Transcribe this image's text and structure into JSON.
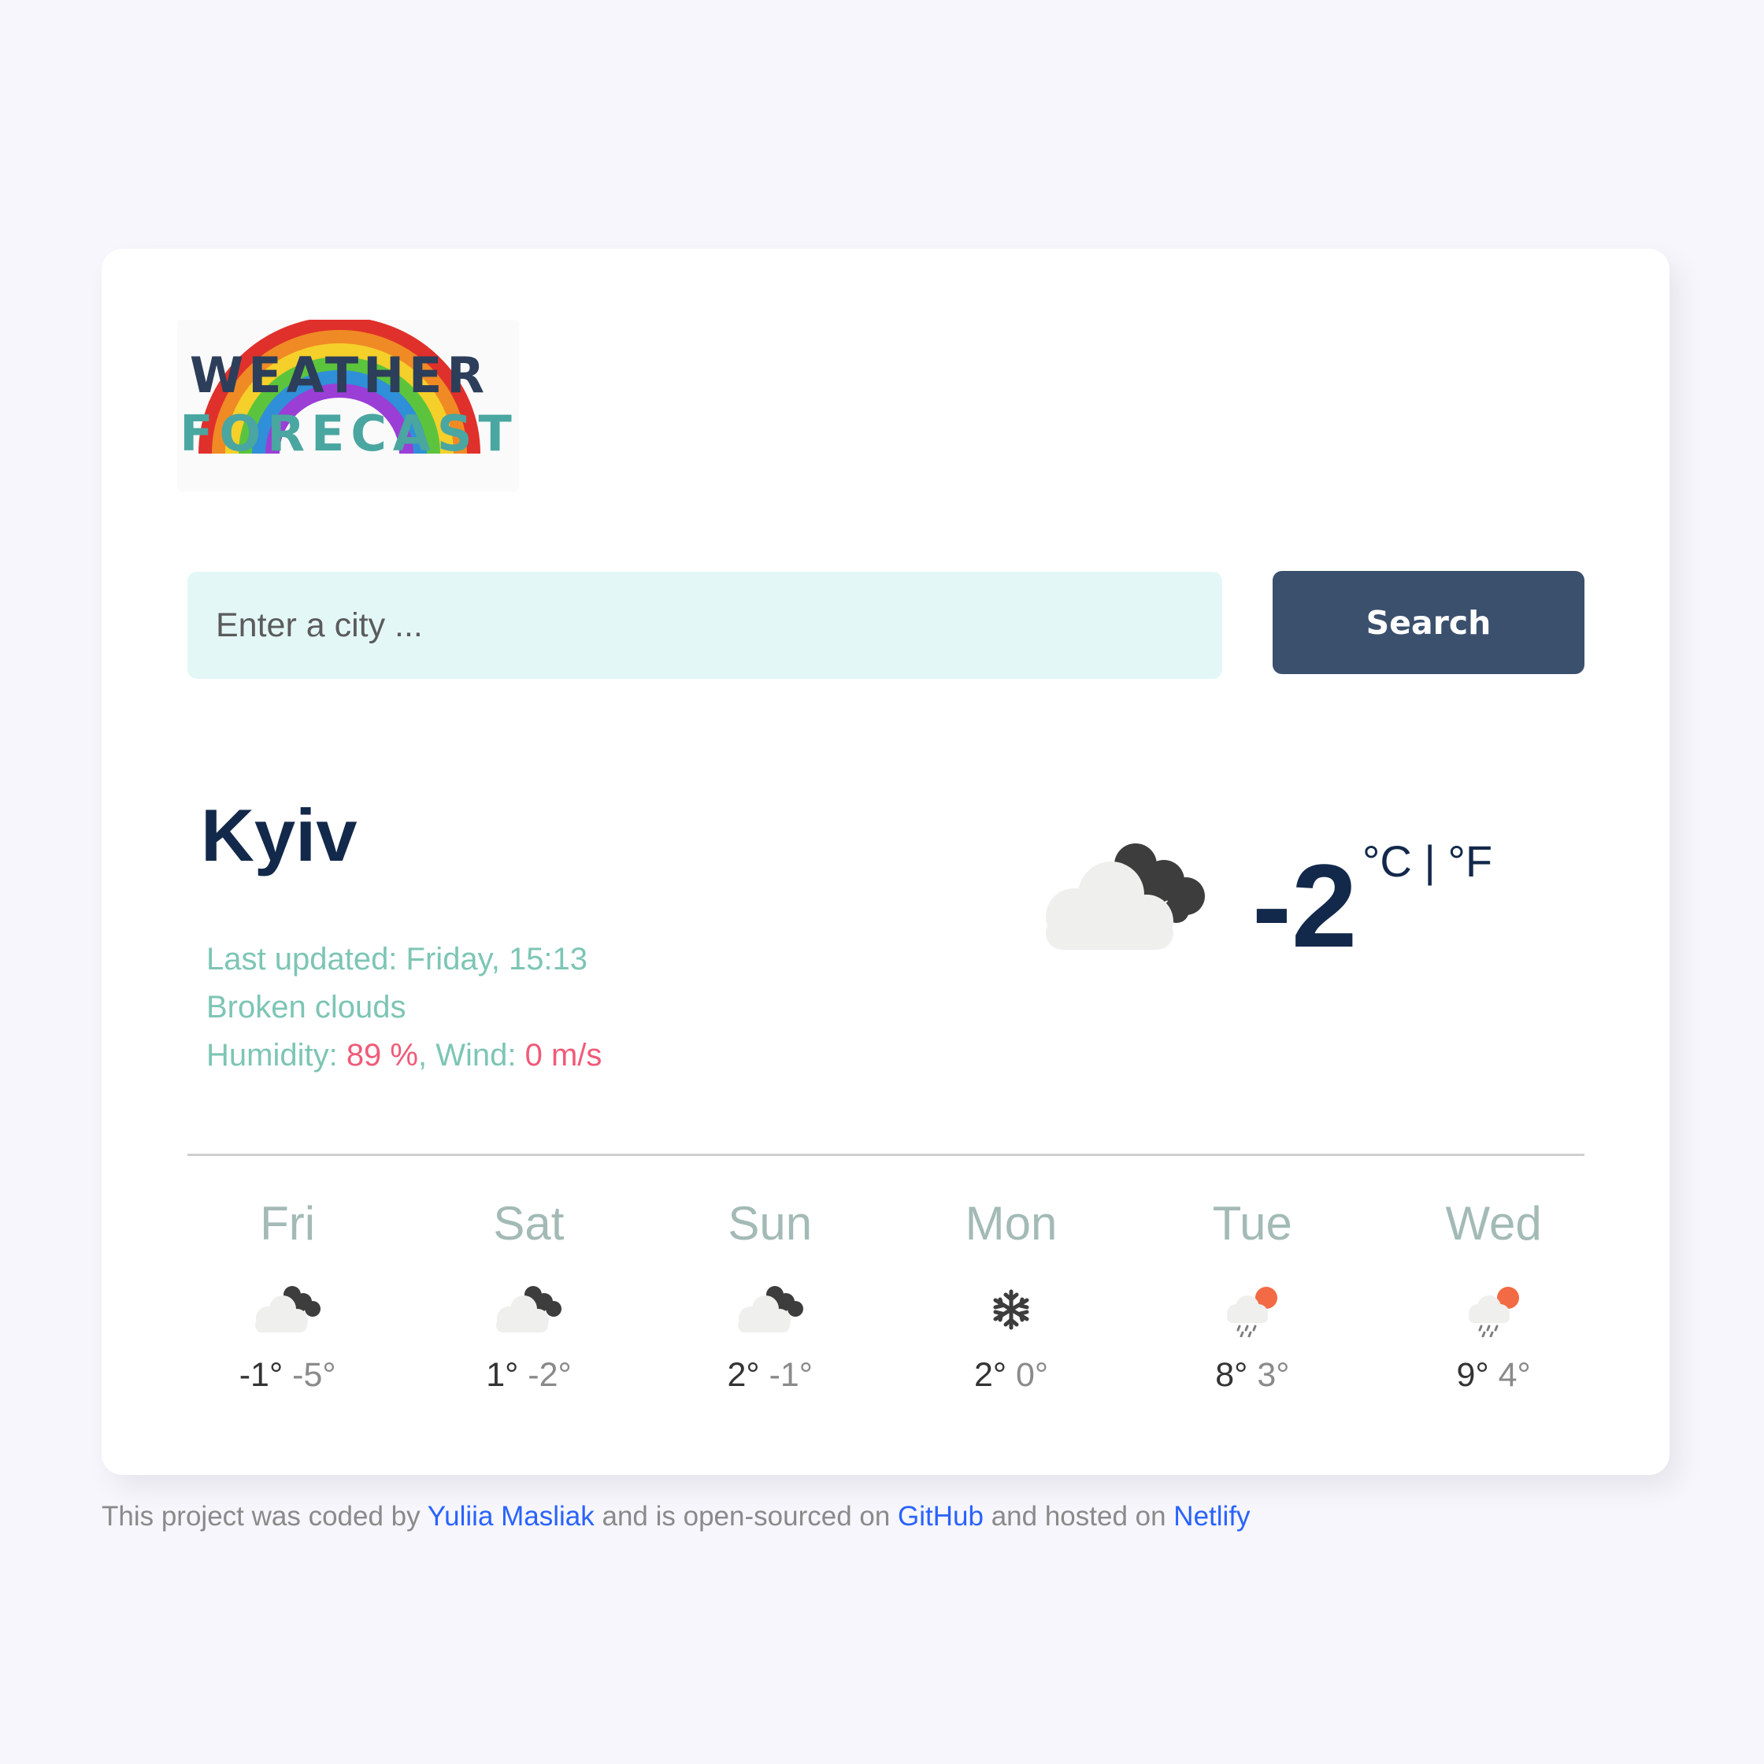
{
  "header": {
    "logo_text_line1": "WEATHER",
    "logo_text_line2": "FORECAST"
  },
  "search": {
    "placeholder": "Enter a city ...",
    "value": "",
    "button_label": "Search"
  },
  "current": {
    "city": "Kyiv",
    "last_updated_label": "Last updated: ",
    "last_updated_value": "Friday, 15:13",
    "description": "Broken clouds",
    "humidity_label": "Humidity: ",
    "humidity_value": "89 %",
    "wind_label": ", Wind: ",
    "wind_value": "0 m/s",
    "temperature": "-2",
    "unit_celsius": "°C",
    "unit_separator": " | ",
    "unit_fahrenheit": "°F",
    "icon": "broken-clouds-icon"
  },
  "forecast": [
    {
      "day": "Fri",
      "max": "-1°",
      "min": "-5°",
      "icon": "broken-clouds-icon"
    },
    {
      "day": "Sat",
      "max": "1°",
      "min": "-2°",
      "icon": "broken-clouds-icon"
    },
    {
      "day": "Sun",
      "max": "2°",
      "min": "-1°",
      "icon": "broken-clouds-icon"
    },
    {
      "day": "Mon",
      "max": "2°",
      "min": "0°",
      "icon": "snowflake-icon"
    },
    {
      "day": "Tue",
      "max": "8°",
      "min": "3°",
      "icon": "rain-sun-icon"
    },
    {
      "day": "Wed",
      "max": "9°",
      "min": "4°",
      "icon": "rain-sun-icon"
    }
  ],
  "footer": {
    "text1": "This project was coded by ",
    "author": "Yuliia Masliak",
    "text2": " and is open-sourced on ",
    "github": "GitHub",
    "text3": " and hosted on ",
    "netlify": "Netlify"
  },
  "colors": {
    "background": "#f6f6fc",
    "card": "#ffffff",
    "accent_dark": "#13294b",
    "button": "#3b506d",
    "input_bg": "#e4f7f7",
    "teal_text": "#7dc5b4",
    "highlight": "#f05a78",
    "link": "#2962ff"
  }
}
